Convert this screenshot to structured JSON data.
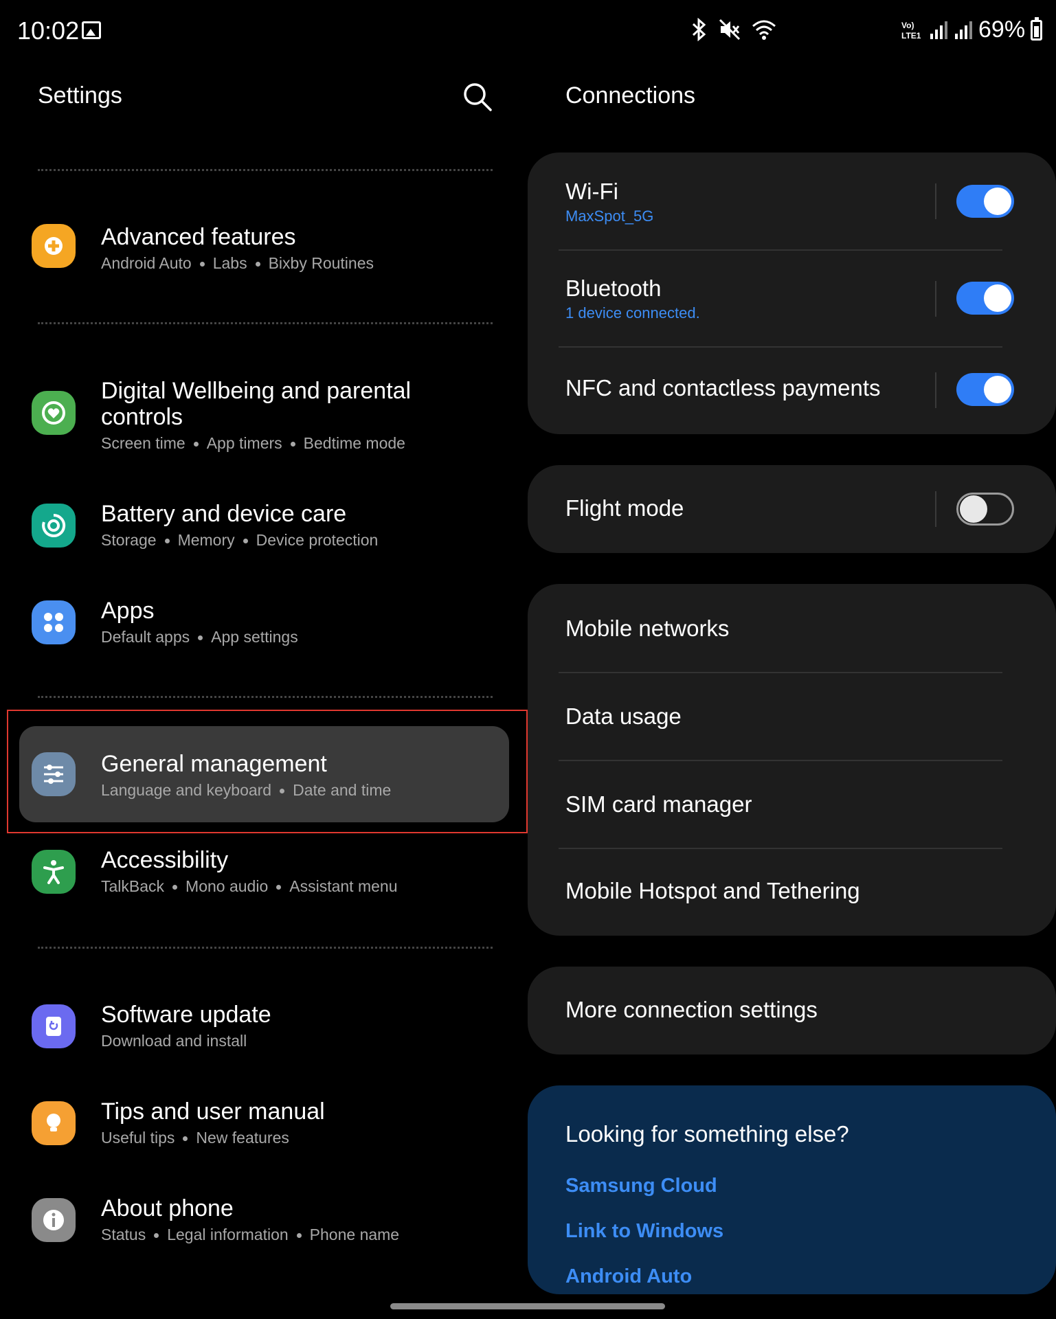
{
  "status_bar": {
    "time": "10:02",
    "battery": "69%",
    "network_label": "Vo)\nLTE1"
  },
  "left_pane": {
    "title": "Settings",
    "items": [
      {
        "title": "Advanced features",
        "subs": [
          "Android Auto",
          "Labs",
          "Bixby Routines"
        ],
        "icon": "advanced-features-icon",
        "color": "#f5a623"
      },
      {
        "title": "Digital Wellbeing and parental controls",
        "subs": [
          "Screen time",
          "App timers",
          "Bedtime mode"
        ],
        "icon": "digital-wellbeing-icon",
        "color": "#4caf50"
      },
      {
        "title": "Battery and device care",
        "subs": [
          "Storage",
          "Memory",
          "Device protection"
        ],
        "icon": "battery-care-icon",
        "color": "#14a88c"
      },
      {
        "title": "Apps",
        "subs": [
          "Default apps",
          "App settings"
        ],
        "icon": "apps-icon",
        "color": "#4a8ff0"
      },
      {
        "title": "General management",
        "subs": [
          "Language and keyboard",
          "Date and time"
        ],
        "icon": "general-management-icon",
        "color": "#6e8aa8"
      },
      {
        "title": "Accessibility",
        "subs": [
          "TalkBack",
          "Mono audio",
          "Assistant menu"
        ],
        "icon": "accessibility-icon",
        "color": "#2e9e4e"
      },
      {
        "title": "Software update",
        "subs": [
          "Download and install"
        ],
        "icon": "software-update-icon",
        "color": "#6b6af0"
      },
      {
        "title": "Tips and user manual",
        "subs": [
          "Useful tips",
          "New features"
        ],
        "icon": "tips-icon",
        "color": "#f5a033"
      },
      {
        "title": "About phone",
        "subs": [
          "Status",
          "Legal information",
          "Phone name"
        ],
        "icon": "about-phone-icon",
        "color": "#8a8a8a"
      }
    ]
  },
  "right_pane": {
    "title": "Connections",
    "wifi": {
      "label": "Wi-Fi",
      "sub": "MaxSpot_5G",
      "on": true
    },
    "bluetooth": {
      "label": "Bluetooth",
      "sub": "1 device connected.",
      "on": true
    },
    "nfc": {
      "label": "NFC and contactless payments",
      "on": true
    },
    "flight": {
      "label": "Flight mode",
      "on": false
    },
    "mobile_networks": "Mobile networks",
    "data_usage": "Data usage",
    "sim_manager": "SIM card manager",
    "hotspot": "Mobile Hotspot and Tethering",
    "more": "More connection settings",
    "help": {
      "title": "Looking for something else?",
      "links": [
        "Samsung Cloud",
        "Link to Windows",
        "Android Auto"
      ]
    }
  }
}
